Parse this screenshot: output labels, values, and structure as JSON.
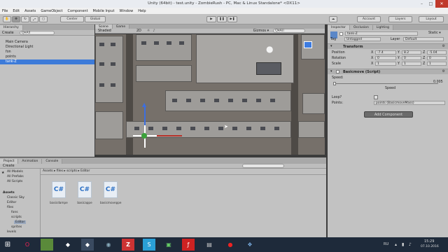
{
  "window": {
    "title": "Unity (64bit) - test.unity - ZombieRush - PC, Mac & Linux Standalone* <DX11>"
  },
  "menu": [
    "File",
    "Edit",
    "Assets",
    "GameObject",
    "Component",
    "Mobile Input",
    "Window",
    "Help"
  ],
  "toolbar": {
    "center": "Center",
    "global": "Global",
    "account": "Account",
    "layers": "Layers",
    "layout": "Layout"
  },
  "hierarchy": {
    "tab": "Hierarchy",
    "create": "Create",
    "search": "Q▾All",
    "items": [
      "Main Camera",
      "Directional Light",
      "fon",
      "points",
      "tank-Z"
    ],
    "selected": "tank-Z"
  },
  "scene": {
    "tab_scene": "Scene",
    "tab_game": "Game",
    "shaded": "Shaded",
    "mode2d": "2D",
    "gizmos": "Gizmos ▾",
    "search": "Q▾All"
  },
  "inspector": {
    "tabs": [
      "Inspector",
      "Occlusion",
      "Lighting"
    ],
    "object_name": "tank-Z",
    "static": "Static ▾",
    "tag_label": "Tag",
    "tag_value": "Untagged",
    "layer_label": "Layer",
    "layer_value": "Default",
    "transform_title": "Transform",
    "position_label": "Position",
    "position": {
      "x": "-7.4",
      "y": "8.2",
      "z": "-5.04"
    },
    "rotation_label": "Rotation",
    "rotation": {
      "x": "0",
      "y": "0",
      "z": "0"
    },
    "scale_label": "Scale",
    "scale": {
      "x": "1",
      "y": "1",
      "z": "1"
    },
    "script_title": "Basicmove (Script)",
    "speed_label": "Speed:",
    "speed_value": "0.005",
    "speed_caption": "Speed",
    "loop_label": "Loop?",
    "points_label": "Points:",
    "points_value": "points (BasicmoveMass)",
    "add_component": "Add Component"
  },
  "project": {
    "tabs": [
      "Project",
      "Animation",
      "Console"
    ],
    "create": "Create",
    "favorites": [
      "All Models",
      "All Prefabs",
      "All Scripts"
    ],
    "tree": [
      "Assets",
      "Classic Sky",
      "Editor",
      "files",
      "fons",
      "scripts",
      "Editor",
      "sprites",
      "levels"
    ],
    "breadcrumb": "Assets ▸ files ▸ scripts ▸ Editor",
    "files": [
      {
        "name": "basicdampe",
        "icon": "C#"
      },
      {
        "name": "basicappe",
        "icon": "C#"
      },
      {
        "name": "basicmoveppe",
        "icon": "C#"
      }
    ]
  },
  "taskbar": {
    "lang": "RU",
    "time": "15:29",
    "date": "07.10.2016"
  }
}
